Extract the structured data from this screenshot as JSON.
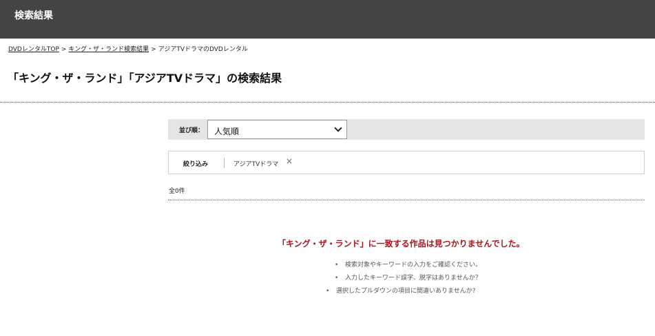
{
  "header": {
    "title": "検索結果"
  },
  "breadcrumb": {
    "items": [
      "DVDレンタルTOP",
      "キング・ザ・ランド検索結果",
      "アジアTVドラマのDVDレンタル"
    ],
    "separator": ">"
  },
  "page_title": "「キング・ザ・ランド」「アジアTVドラマ」の検索結果",
  "sort": {
    "label": "並び順：",
    "selected": "人気順"
  },
  "filter": {
    "label": "絞り込み",
    "chips": [
      {
        "label": "アジアTVドラマ",
        "remove_icon": "close-icon"
      }
    ]
  },
  "results": {
    "count_text": "全0件"
  },
  "not_found": {
    "message": "「キング・ザ・ランド」に一致する作品は見つかりませんでした。",
    "tips": [
      "検索対象やキーワードの入力をご確認ください。",
      "入力したキーワード誤字、脱字はありませんか？",
      "選択したプルダウンの項目に間違いありませんか?"
    ]
  },
  "colors": {
    "header_bg": "#444444",
    "error_text": "#a8151c",
    "sort_bar_bg": "#e5e5e5"
  }
}
